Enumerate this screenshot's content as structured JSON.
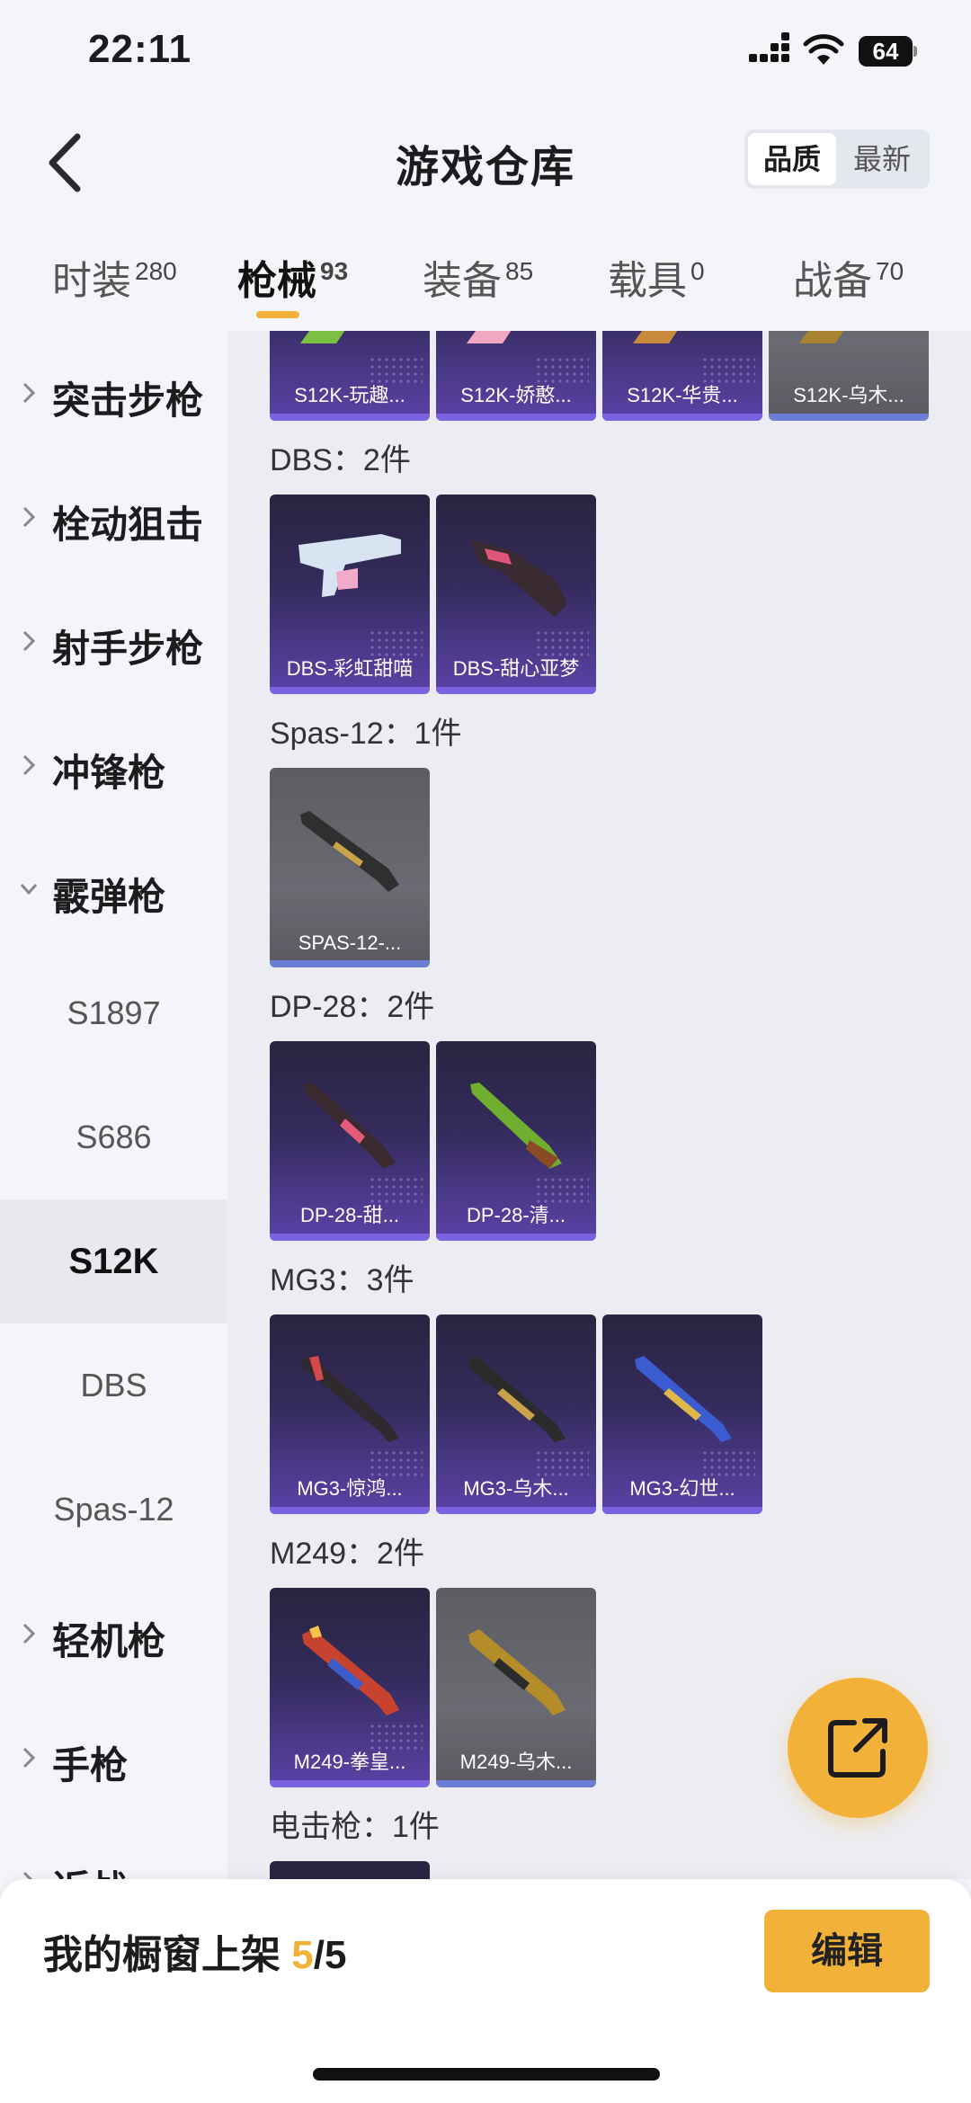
{
  "status_bar": {
    "time": "22:11",
    "battery": "64"
  },
  "header": {
    "title": "游戏仓库",
    "sort_options": [
      "品质",
      "最新"
    ]
  },
  "tabs": [
    {
      "label": "时装",
      "count": "280"
    },
    {
      "label": "枪械",
      "count": "93"
    },
    {
      "label": "装备",
      "count": "85"
    },
    {
      "label": "载具",
      "count": "0"
    },
    {
      "label": "战备",
      "count": "70"
    }
  ],
  "sidebar": {
    "categories": [
      {
        "label": "突击步枪"
      },
      {
        "label": "栓动狙击"
      },
      {
        "label": "射手步枪"
      },
      {
        "label": "冲锋枪"
      },
      {
        "label": "霰弹枪"
      }
    ],
    "sub_items": [
      "S1897",
      "S686",
      "S12K",
      "DBS",
      "Spas-12"
    ],
    "after": [
      {
        "label": "轻机枪"
      },
      {
        "label": "手枪"
      },
      {
        "label": "近战"
      }
    ]
  },
  "content": {
    "top_row": [
      "S12K-玩趣...",
      "S12K-娇憨...",
      "S12K-华贵...",
      "S12K-乌木..."
    ],
    "groups": [
      {
        "title": "DBS：2件",
        "items": [
          "DBS-彩虹甜喵",
          "DBS-甜心亚梦"
        ]
      },
      {
        "title": "Spas-12：1件",
        "items": [
          "SPAS-12-..."
        ]
      },
      {
        "title": "DP-28：2件",
        "items": [
          "DP-28-甜...",
          "DP-28-清..."
        ]
      },
      {
        "title": "MG3：3件",
        "items": [
          "MG3-惊鸿...",
          "MG3-乌木...",
          "MG3-幻世..."
        ]
      },
      {
        "title": "M249：2件",
        "items": [
          "M249-拳皇...",
          "M249-乌木..."
        ]
      },
      {
        "title": "电击枪：1件",
        "items": []
      }
    ]
  },
  "bottom_bar": {
    "shelf_label": "我的橱窗上架 ",
    "shelf_count": "5",
    "shelf_total": "/5",
    "edit_label": "编辑"
  },
  "colors": {
    "accent": "#f2b23a",
    "card_purple": "#5b43a8",
    "card_gray": "#6a6b72"
  }
}
